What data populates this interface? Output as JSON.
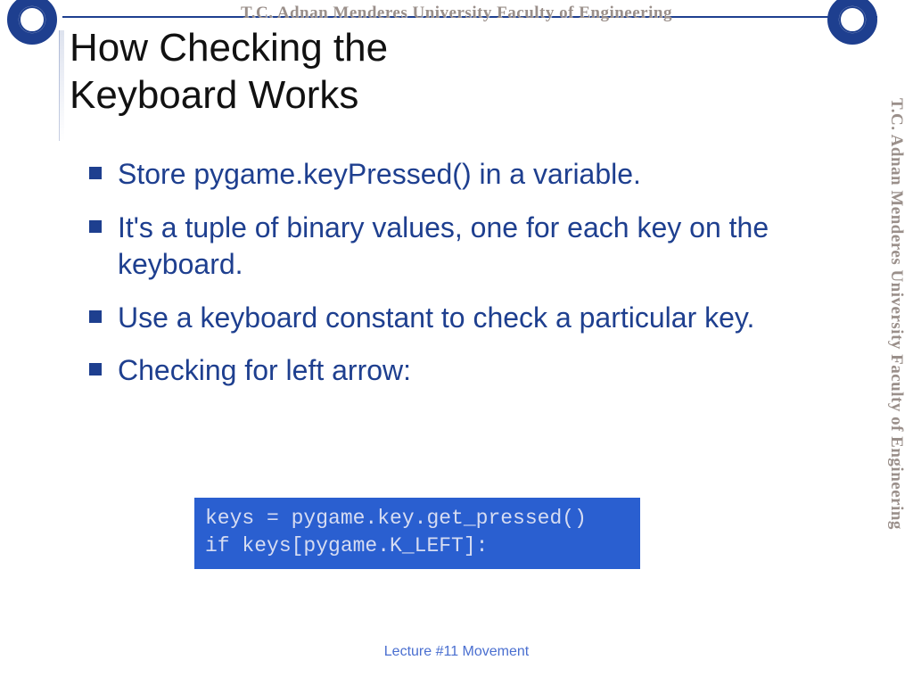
{
  "header": {
    "institution": "T.C.   Adnan Menderes University   Faculty of Engineering"
  },
  "title": {
    "line1": "How Checking the",
    "line2": "Keyboard Works"
  },
  "bullets": [
    "Store pygame.keyPressed() in a variable.",
    "It's a tuple of binary values, one for each key on the keyboard.",
    "Use a keyboard constant to check a particular key.",
    "Checking for left arrow:"
  ],
  "code": {
    "line1": "keys = pygame.key.get_pressed()",
    "line2": "if keys[pygame.K_LEFT]:"
  },
  "footer": "Lecture #11 Movement"
}
